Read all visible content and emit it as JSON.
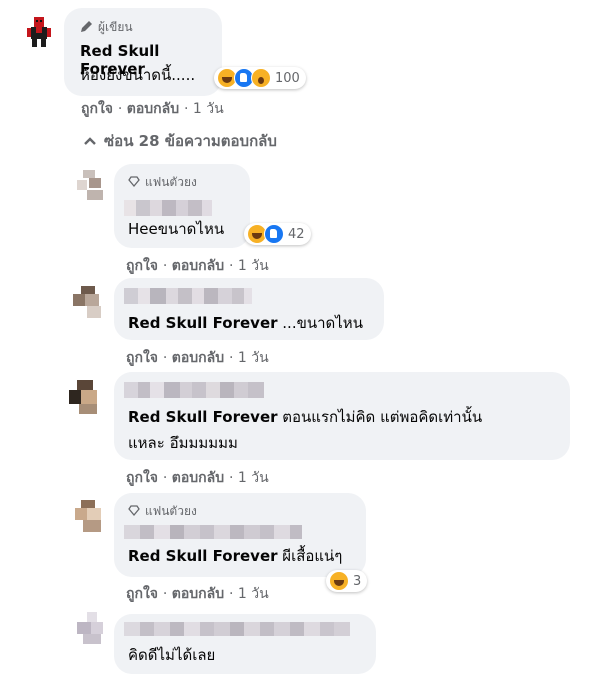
{
  "comment": {
    "badge": "ผู้เขียน",
    "name": "Red Skull Forever",
    "text": "ห้องยังขนาดนี้.....",
    "reactions": {
      "icons": [
        "haha-icon",
        "like-icon",
        "wow-icon"
      ],
      "count": "100"
    },
    "actions": {
      "like": "ถูกใจ",
      "reply": "ตอบกลับ",
      "time": "1 วัน"
    }
  },
  "hide_replies": {
    "icon": "chevron-up-icon",
    "label": "ซ่อน 28 ข้อความตอบกลับ"
  },
  "replies": [
    {
      "badge": "แฟนตัวยง",
      "text": "Heeขนาดไหน",
      "reactions": {
        "icons": [
          "haha-icon",
          "like-icon"
        ],
        "count": "42"
      },
      "actions": {
        "like": "ถูกใจ",
        "reply": "ตอบกลับ",
        "time": "1 วัน"
      }
    },
    {
      "mention": "Red Skull Forever",
      "text": " ...ขนาดไหน",
      "actions": {
        "like": "ถูกใจ",
        "reply": "ตอบกลับ",
        "time": "1 วัน"
      }
    },
    {
      "mention": "Red Skull Forever",
      "text_line1": " ตอนแรกไม่คิด แต่พอคิดเท่านั้น",
      "text_line2": "แหละ อึมมมมมม",
      "actions": {
        "like": "ถูกใจ",
        "reply": "ตอบกลับ",
        "time": "1 วัน"
      }
    },
    {
      "badge": "แฟนตัวยง",
      "mention": "Red Skull Forever",
      "text": " ผีเสื้อแน่ๆ",
      "reactions": {
        "icons": [
          "haha-icon"
        ],
        "count": "3"
      },
      "actions": {
        "like": "ถูกใจ",
        "reply": "ตอบกลับ",
        "time": "1 วัน"
      }
    },
    {
      "text": "คิดดีไม่ได้เลย"
    }
  ],
  "colors": {
    "bubble": "#f0f2f5",
    "secondary_text": "#65676b",
    "like_blue": "#1877f2",
    "haha_yellow": "#f7b125"
  }
}
